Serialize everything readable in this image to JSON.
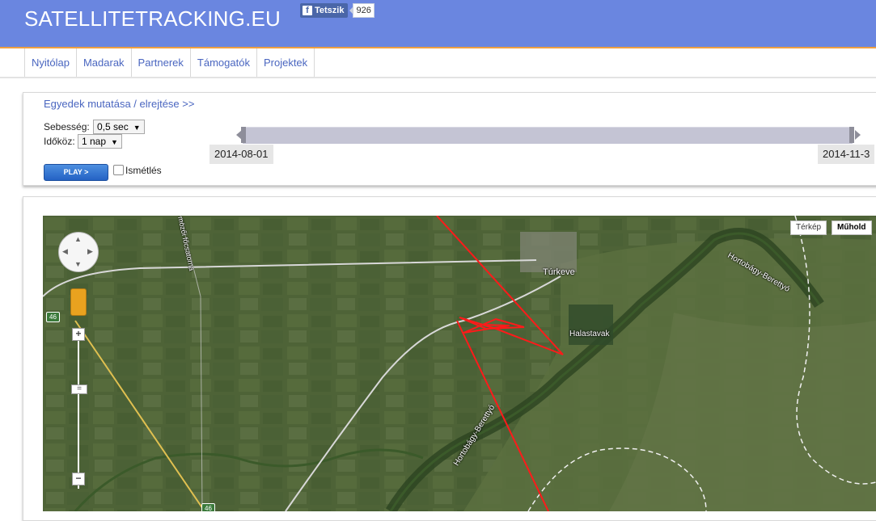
{
  "header": {
    "site_title": "SATELLITETRACKING.EU",
    "fb_like_label": "Tetszik",
    "fb_icon_glyph": "f",
    "fb_like_count": "926",
    "bg_color": "#6a86e0"
  },
  "nav": {
    "items": [
      {
        "label": "Nyitólap"
      },
      {
        "label": "Madarak"
      },
      {
        "label": "Partnerek"
      },
      {
        "label": "Támogatók"
      },
      {
        "label": "Projektek"
      }
    ]
  },
  "controls": {
    "toggle_link": "Egyedek mutatása / elrejtése >>",
    "speed_label": "Sebesség:",
    "speed_value": "0,5 sec",
    "interval_label": "Időköz:",
    "interval_value": "1 nap",
    "dropdown_arrow": "▼",
    "play_label": "PLAY >",
    "repeat_label": "Ismétlés",
    "repeat_checked": false,
    "date_start": "2014-08-01",
    "date_end": "2014-11-3"
  },
  "map": {
    "type_map_label": "Térkép",
    "type_satellite_label": "Műhold",
    "active_type": "Műhold",
    "zoom_in_label": "+",
    "zoom_slider_label": "=",
    "zoom_out_label": "−",
    "pan_arrows": {
      "up": "▲",
      "down": "▼",
      "left": "◀",
      "right": "▶"
    },
    "labels": {
      "town": "Túrkeve",
      "ponds": "Halastavak",
      "river_upper": "Hortobágy-Berettyó",
      "river_lower": "Hortobágy-Berettyó",
      "canal": "mözői főcsatorna"
    },
    "road_number": "46",
    "track_color": "#ff1a1a"
  }
}
